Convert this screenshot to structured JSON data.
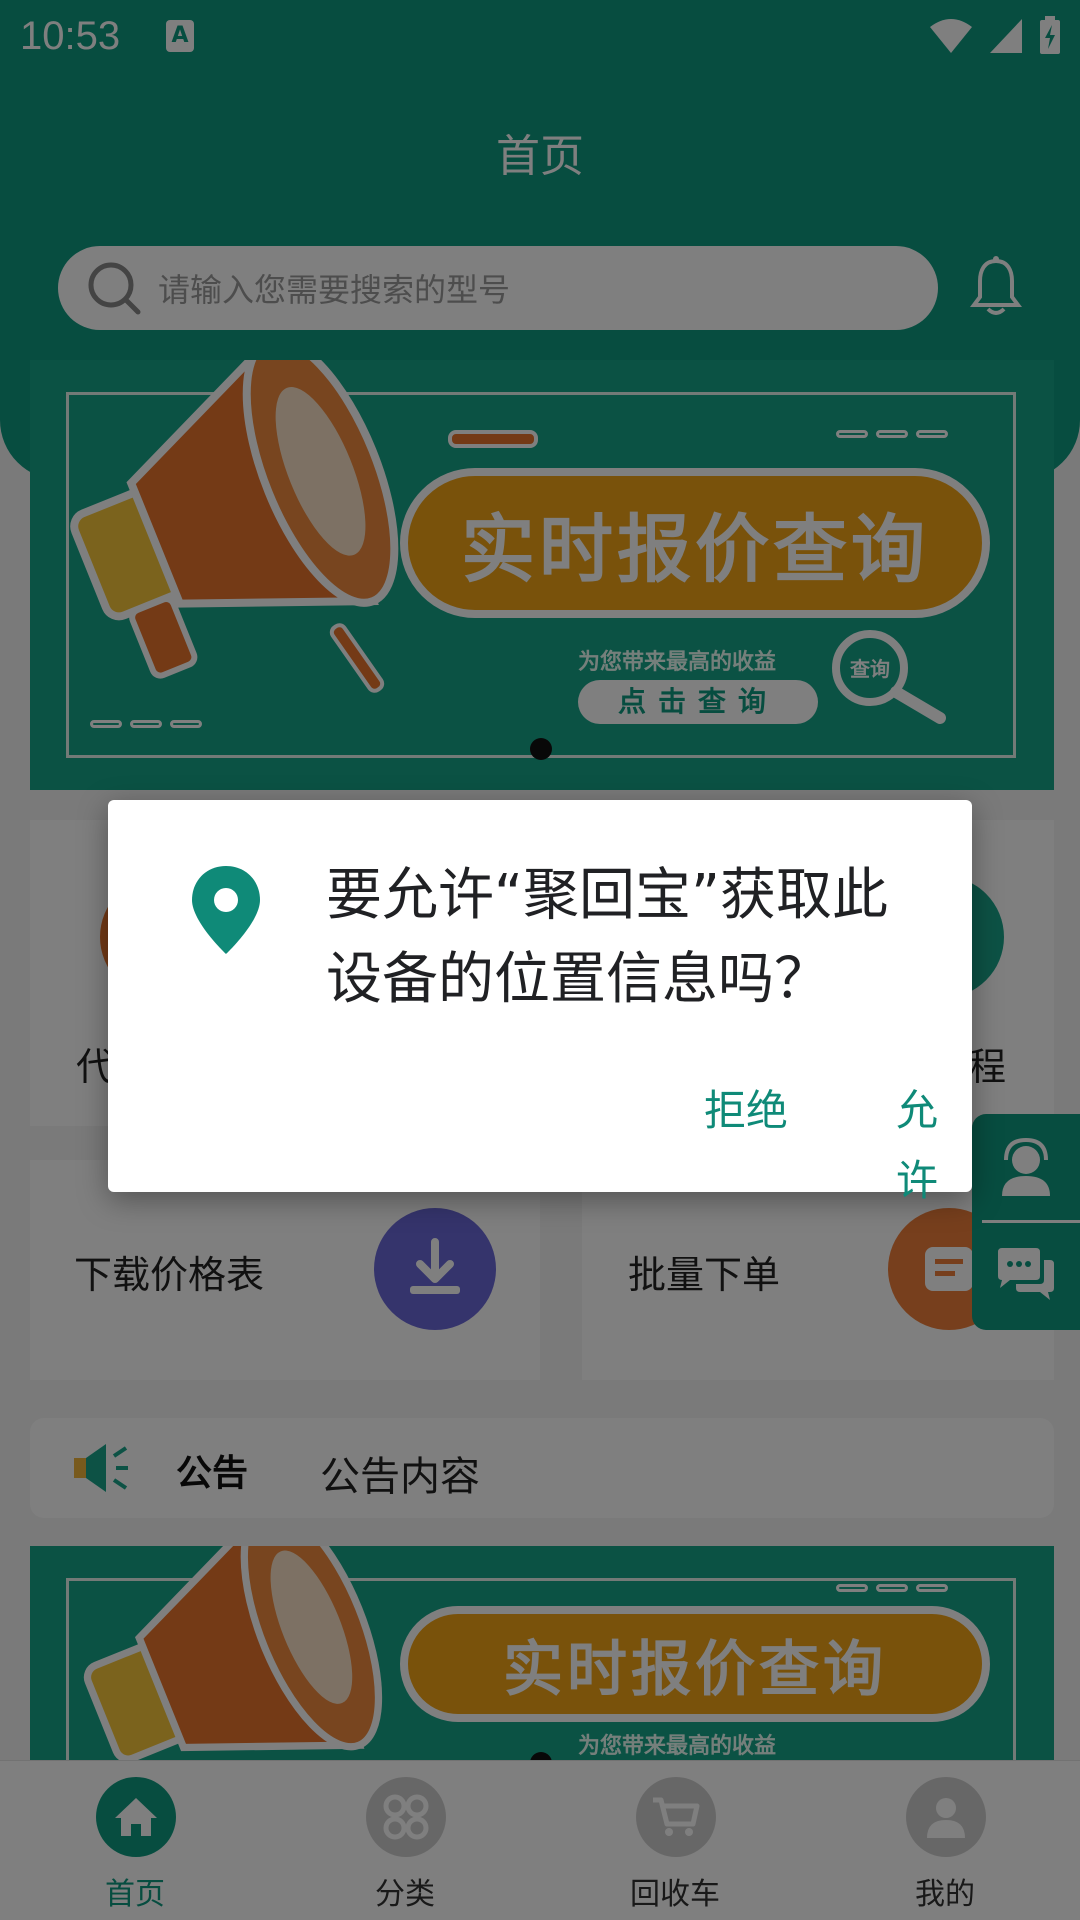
{
  "status_bar": {
    "time": "10:53",
    "notification_icon": "A"
  },
  "header": {
    "title": "首页",
    "search_placeholder": "请输入您需要搜索的型号"
  },
  "banner": {
    "headline": "实时报价查询",
    "subline": "为您带来最高的收益",
    "button": "点击查询",
    "badge": "查询"
  },
  "grid": {
    "row1_left_label": "代",
    "row1_right_label": "程",
    "download_label": "下载价格表",
    "batch_label": "批量下单"
  },
  "notice": {
    "label": "公告",
    "content": "公告内容"
  },
  "tabs": [
    {
      "label": "首页",
      "icon": "home-icon"
    },
    {
      "label": "分类",
      "icon": "category-icon"
    },
    {
      "label": "回收车",
      "icon": "cart-icon"
    },
    {
      "label": "我的",
      "icon": "user-icon"
    }
  ],
  "dialog": {
    "message": "要允许“聚回宝”获取此设备的位置信息吗？",
    "deny": "拒绝",
    "allow": "允许"
  },
  "colors": {
    "brand": "#0e9b80",
    "banner_pill": "#f2a516",
    "dialog_accent": "#0f8a78"
  }
}
